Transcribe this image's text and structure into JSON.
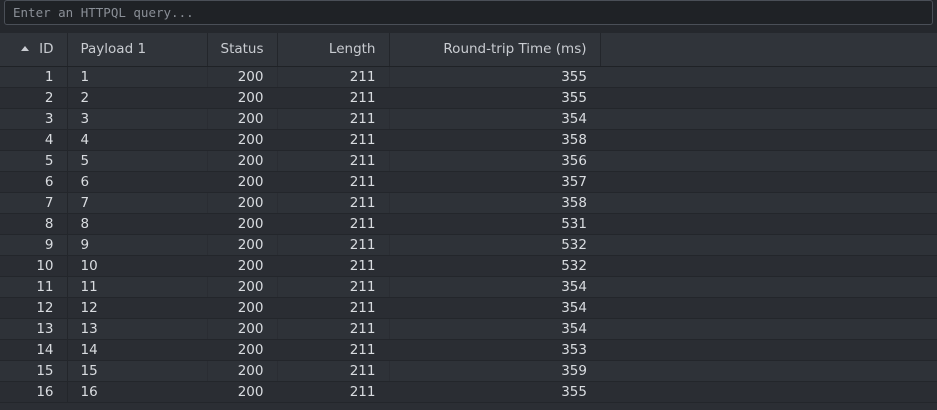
{
  "query": {
    "placeholder": "Enter an HTTPQL query...",
    "value": ""
  },
  "table": {
    "columns": [
      {
        "key": "id",
        "label": "ID",
        "sorted": "ascending"
      },
      {
        "key": "payload",
        "label": "Payload 1"
      },
      {
        "key": "status",
        "label": "Status"
      },
      {
        "key": "length",
        "label": "Length"
      },
      {
        "key": "rtt",
        "label": "Round-trip Time (ms)"
      }
    ],
    "rows": [
      {
        "id": "1",
        "payload": "1",
        "status": "200",
        "length": "211",
        "rtt": "355"
      },
      {
        "id": "2",
        "payload": "2",
        "status": "200",
        "length": "211",
        "rtt": "355"
      },
      {
        "id": "3",
        "payload": "3",
        "status": "200",
        "length": "211",
        "rtt": "354"
      },
      {
        "id": "4",
        "payload": "4",
        "status": "200",
        "length": "211",
        "rtt": "358"
      },
      {
        "id": "5",
        "payload": "5",
        "status": "200",
        "length": "211",
        "rtt": "356"
      },
      {
        "id": "6",
        "payload": "6",
        "status": "200",
        "length": "211",
        "rtt": "357"
      },
      {
        "id": "7",
        "payload": "7",
        "status": "200",
        "length": "211",
        "rtt": "358"
      },
      {
        "id": "8",
        "payload": "8",
        "status": "200",
        "length": "211",
        "rtt": "531"
      },
      {
        "id": "9",
        "payload": "9",
        "status": "200",
        "length": "211",
        "rtt": "532"
      },
      {
        "id": "10",
        "payload": "10",
        "status": "200",
        "length": "211",
        "rtt": "532"
      },
      {
        "id": "11",
        "payload": "11",
        "status": "200",
        "length": "211",
        "rtt": "354"
      },
      {
        "id": "12",
        "payload": "12",
        "status": "200",
        "length": "211",
        "rtt": "354"
      },
      {
        "id": "13",
        "payload": "13",
        "status": "200",
        "length": "211",
        "rtt": "354"
      },
      {
        "id": "14",
        "payload": "14",
        "status": "200",
        "length": "211",
        "rtt": "353"
      },
      {
        "id": "15",
        "payload": "15",
        "status": "200",
        "length": "211",
        "rtt": "359"
      },
      {
        "id": "16",
        "payload": "16",
        "status": "200",
        "length": "211",
        "rtt": "355"
      }
    ]
  }
}
